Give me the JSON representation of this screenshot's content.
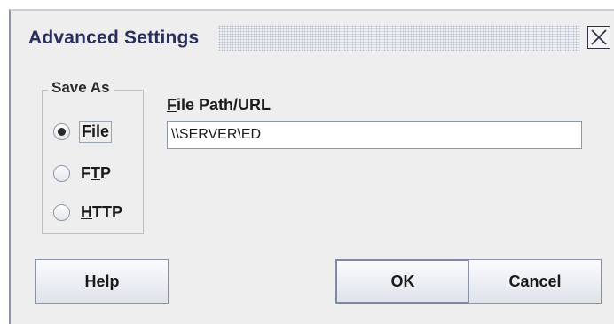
{
  "dialog": {
    "title": "Advanced Settings"
  },
  "save_as": {
    "legend": "Save As",
    "options": [
      {
        "mnemonic_pre": "F",
        "mnemonic": "i",
        "rest": "le",
        "selected": true
      },
      {
        "mnemonic_pre": "F",
        "mnemonic": "T",
        "rest": "P",
        "selected": false
      },
      {
        "mnemonic_pre": "",
        "mnemonic": "H",
        "rest": "TTP",
        "selected": false
      }
    ]
  },
  "path": {
    "label_mnemonic": "F",
    "label_rest": "ile Path/URL",
    "value": "\\\\SERVER\\ED"
  },
  "buttons": {
    "help_mnemonic": "H",
    "help_rest": "elp",
    "ok_mnemonic": "O",
    "ok_rest": "K",
    "cancel": "Cancel"
  },
  "icons": {
    "close": "close-icon",
    "radio": "radio-button"
  }
}
